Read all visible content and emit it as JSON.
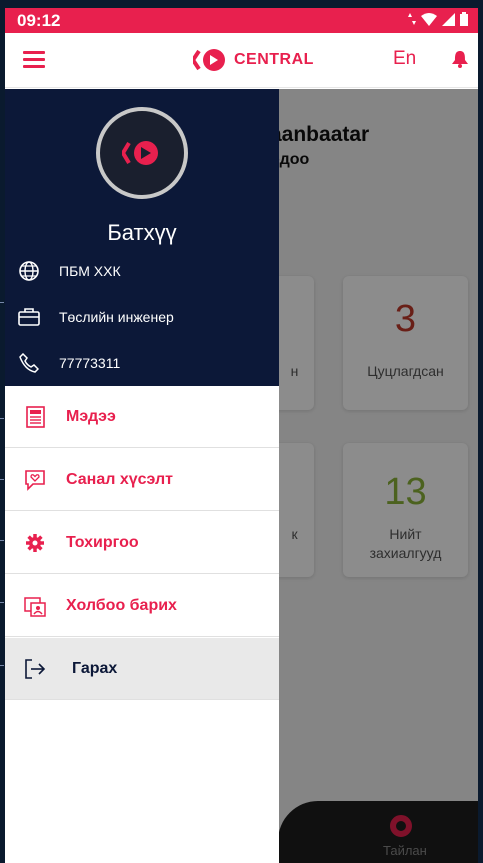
{
  "status_bar": {
    "time": "09:12",
    "color": "#e8204e"
  },
  "app_bar": {
    "logo_text": "CENTRAL",
    "language": "En",
    "brand_color": "#e8204e"
  },
  "background": {
    "title": "aanbaatar",
    "subtitle": "одоо",
    "cards": [
      {
        "number": "",
        "label": "н"
      },
      {
        "number": "3",
        "label": "Цуцлагдсан",
        "number_color": "#c0392b"
      },
      {
        "number": "",
        "label": "к"
      },
      {
        "number": "13",
        "label": "Нийт захиалгууд",
        "number_color": "#8bb33a"
      }
    ],
    "bottom_nav_label": "Тайлан"
  },
  "drawer": {
    "name": "Батхүү",
    "info": [
      {
        "icon": "globe-icon",
        "text": "ПБМ ХХК"
      },
      {
        "icon": "briefcase-icon",
        "text": "Төслийн инженер"
      },
      {
        "icon": "phone-icon",
        "text": "77773311"
      }
    ],
    "menu": [
      {
        "icon": "news-icon",
        "label": "Мэдээ"
      },
      {
        "icon": "feedback-icon",
        "label": "Санал хүсэлт"
      },
      {
        "icon": "gear-icon",
        "label": "Тохиргоо"
      },
      {
        "icon": "contact-icon",
        "label": "Холбоо барих"
      },
      {
        "icon": "logout-icon",
        "label": "Гарах"
      }
    ],
    "header_color": "#0c1838"
  }
}
